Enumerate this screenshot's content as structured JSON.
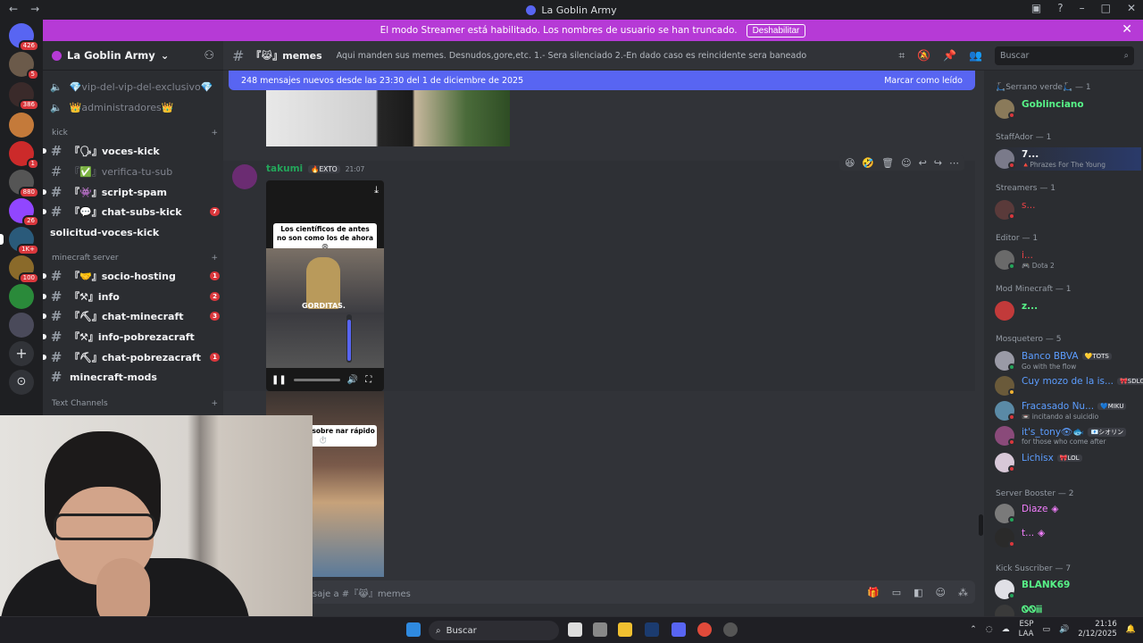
{
  "window": {
    "title": "La Goblin Army"
  },
  "banner": {
    "text": "El modo Streamer está habilitado. Los nombres de usuario se han truncado.",
    "button": "Deshabilitar"
  },
  "guild": {
    "name": "La Goblin Army"
  },
  "server_badges": [
    "426",
    "5",
    "386",
    "1",
    "880",
    "26",
    "1K+",
    "100"
  ],
  "sidebar": {
    "channels_top": [
      {
        "label": "💎vip-del-vip-del-exclusivo💎"
      },
      {
        "label": "👑administradores👑"
      }
    ],
    "cat_kick": "kick",
    "kick_channels": [
      {
        "label": "『🗣』voces-kick",
        "badge": ""
      },
      {
        "label": "『✅』verifica-tu-sub",
        "badge": ""
      },
      {
        "label": "『👾』script-spam",
        "badge": ""
      },
      {
        "label": "『💬』chat-subs-kick",
        "badge": "7"
      },
      {
        "label": "solicitud-voces-kick",
        "badge": ""
      }
    ],
    "cat_minecraft": "minecraft server",
    "minecraft_channels": [
      {
        "label": "『🤝』socio-hosting",
        "badge": "1"
      },
      {
        "label": "『⚒』info",
        "badge": "2"
      },
      {
        "label": "『⛏』chat-minecraft",
        "badge": "3"
      },
      {
        "label": "『⚒』info-pobrezacraft",
        "badge": ""
      },
      {
        "label": "『⛏』chat-pobrezacraft",
        "badge": "1"
      },
      {
        "label": "minecraft-mods",
        "badge": ""
      }
    ],
    "cat_text": "Text Channels"
  },
  "channel": {
    "name": "『😹』memes",
    "topic": "Aqui manden sus memes. Desnudos,gore,etc. 1.- Sera silenciado 2.-En dado caso es reincidente sera baneado"
  },
  "search": {
    "placeholder": "Buscar"
  },
  "new_messages": {
    "text": "248 mensajes nuevos desde las 23:30 del 1 de diciembre de 2025",
    "action": "Marcar como leído"
  },
  "message": {
    "author": "takumi",
    "tag": "🔥EXTO",
    "time": "21:07",
    "video_caption": "Los científicos de antes no son como los de ahora 😩",
    "video_word": "GORDITAS.",
    "video2_caption": "le He-Man sobre nar rápido ⏱️"
  },
  "composer": {
    "placeholder": "saje a #『😹』memes"
  },
  "members": {
    "roles": [
      {
        "title": "🛴Serrano verde🛴 — 1"
      },
      {
        "title": "StaffAdor — 1"
      },
      {
        "title": "Streamers — 1"
      },
      {
        "title": "Editor — 1"
      },
      {
        "title": "Mod Minecraft — 1"
      },
      {
        "title": "Mosquetero — 5"
      },
      {
        "title": "Server Booster — 2"
      },
      {
        "title": "Kick Suscriber — 7"
      }
    ],
    "list": [
      {
        "name": "Goblinciano",
        "sub": "",
        "tag": "",
        "color": "#57f287"
      },
      {
        "name": "7...",
        "sub": "🔺Phrazes For The Young",
        "tag": "",
        "color": "#f2f3f5"
      },
      {
        "name": "s...",
        "sub": "",
        "tag": "",
        "color": "#ed4245"
      },
      {
        "name": "i...",
        "sub": "🎮 Dota 2",
        "tag": "",
        "color": "#ed4245"
      },
      {
        "name": "z...",
        "sub": "",
        "tag": "",
        "color": "#57f287"
      },
      {
        "name": "Banco BBVA",
        "sub": "Go with the flow",
        "tag": "💛TOTS",
        "color": "#5c9dff"
      },
      {
        "name": "Cuy mozo de la is...",
        "sub": "",
        "tag": "🎀SDLG",
        "color": "#5c9dff"
      },
      {
        "name": "Fracasado Nu...",
        "sub": "📼 incitando al suicidio",
        "tag": "💙MIKU",
        "color": "#5c9dff"
      },
      {
        "name": "it's_tony👁🐟",
        "sub": "for those who come after",
        "tag": "📧シオリン",
        "color": "#5c9dff"
      },
      {
        "name": "Lichisx",
        "sub": "",
        "tag": "🎀LOL",
        "color": "#5c9dff"
      },
      {
        "name": "Diaze",
        "sub": "",
        "tag": "",
        "color": "#f47fff"
      },
      {
        "name": "t...",
        "sub": "",
        "tag": "",
        "color": "#f47fff"
      },
      {
        "name": "BLANK69",
        "sub": "",
        "tag": "",
        "color": "#57f287"
      },
      {
        "name": "ᏫᏫᎥᎥᎥ",
        "sub": "",
        "tag": "",
        "color": "#57f287"
      }
    ]
  },
  "taskbar": {
    "search": "Buscar",
    "lang": "ESP",
    "lang2": "LAA",
    "time": "21:16",
    "date": "2/12/2025"
  },
  "colors": {
    "banner": "#b63ad6",
    "blurple": "#5865f2",
    "online": "#23a55a",
    "dnd": "#da373c"
  }
}
